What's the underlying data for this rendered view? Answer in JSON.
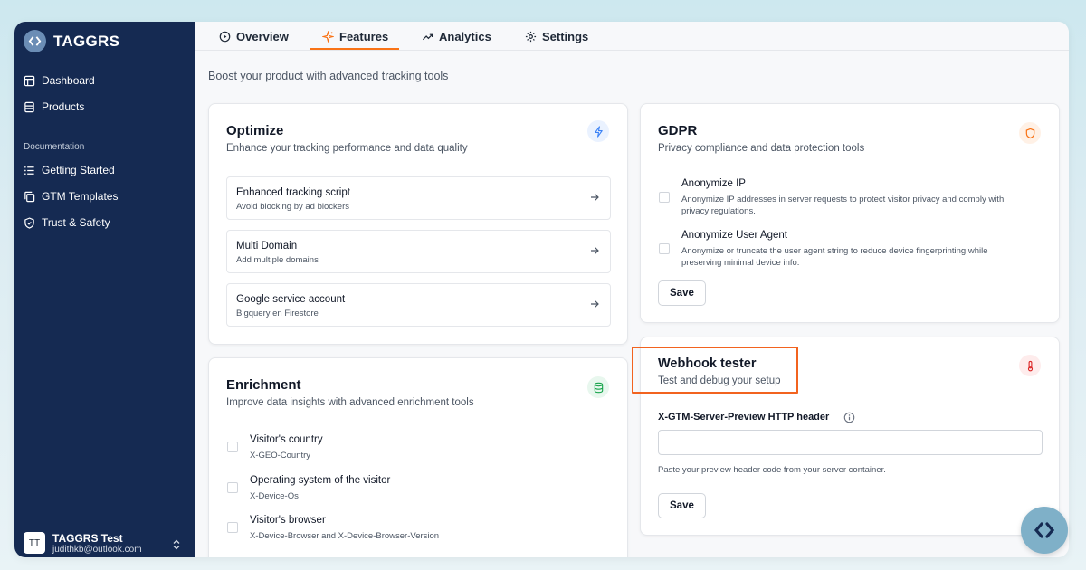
{
  "brand": {
    "name": "TAGGRS"
  },
  "sidebar": {
    "items": [
      {
        "label": "Dashboard",
        "icon": "dashboard-icon"
      },
      {
        "label": "Products",
        "icon": "products-icon"
      }
    ],
    "section_title": "Documentation",
    "doc_items": [
      {
        "label": "Getting Started",
        "icon": "list-icon"
      },
      {
        "label": "GTM Templates",
        "icon": "copy-icon"
      },
      {
        "label": "Trust & Safety",
        "icon": "shield-icon"
      }
    ],
    "user": {
      "initials": "TT",
      "name": "TAGGRS Test",
      "email": "judithkb@outlook.com"
    }
  },
  "tabs": [
    {
      "label": "Overview",
      "icon": "play-circle-icon"
    },
    {
      "label": "Features",
      "icon": "sparkle-icon",
      "active": true
    },
    {
      "label": "Analytics",
      "icon": "trend-up-icon"
    },
    {
      "label": "Settings",
      "icon": "gear-icon"
    }
  ],
  "page": {
    "subtitle": "Boost your product with advanced tracking tools"
  },
  "optimize": {
    "title": "Optimize",
    "description": "Enhance your tracking performance and data quality",
    "icon": "lightning-icon",
    "features": [
      {
        "name": "Enhanced tracking script",
        "sub": "Avoid blocking by ad blockers"
      },
      {
        "name": "Multi Domain",
        "sub": "Add multiple domains"
      },
      {
        "name": "Google service account",
        "sub": "Bigquery en Firestore"
      }
    ]
  },
  "enrichment": {
    "title": "Enrichment",
    "description": "Improve data insights with advanced enrichment tools",
    "icon": "database-icon",
    "options": [
      {
        "name": "Visitor's country",
        "header": "X-GEO-Country"
      },
      {
        "name": "Operating system of the visitor",
        "header": "X-Device-Os"
      },
      {
        "name": "Visitor's browser",
        "header": "X-Device-Browser and X-Device-Browser-Version"
      }
    ]
  },
  "gdpr": {
    "title": "GDPR",
    "description": "Privacy compliance and data protection tools",
    "icon": "shield-icon",
    "options": [
      {
        "name": "Anonymize IP",
        "desc_line1": "Anonymize IP addresses in server requests to protect visitor privacy and comply with",
        "desc_line2": "privacy regulations."
      },
      {
        "name": "Anonymize User Agent",
        "desc_line1": "Anonymize or truncate the user agent string to reduce device fingerprinting while",
        "desc_line2": "preserving minimal device info."
      }
    ],
    "save_label": "Save"
  },
  "webhook": {
    "title": "Webhook tester",
    "description": "Test and debug your setup",
    "icon": "thermometer-icon",
    "field_label": "X-GTM-Server-Preview HTTP header",
    "field_value": "",
    "field_help": "Paste your preview header code from your server container.",
    "save_label": "Save"
  },
  "colors": {
    "sidebar_bg": "#152a52",
    "accent_orange": "#f97316",
    "highlight": "#f2631f",
    "optimize_icon": "#3b82f6",
    "enrichment_icon": "#16a34a",
    "gdpr_icon": "#f97316",
    "webhook_icon": "#dc2626"
  }
}
